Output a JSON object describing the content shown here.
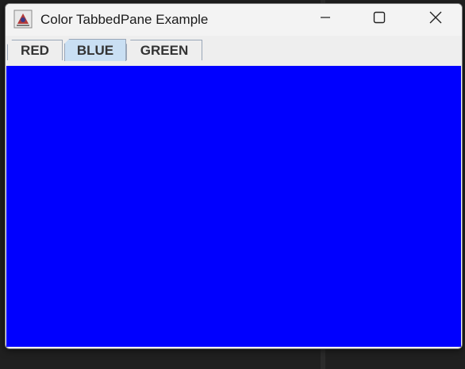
{
  "window": {
    "title": "Color TabbedPane Example"
  },
  "titlebar_buttons": {
    "minimize_icon": "minimize-icon",
    "maximize_icon": "maximize-icon",
    "close_icon": "close-icon"
  },
  "tabs": [
    {
      "label": "RED",
      "selected": false
    },
    {
      "label": "BLUE",
      "selected": true
    },
    {
      "label": "GREEN",
      "selected": false
    }
  ],
  "content": {
    "color": "#0000ff"
  },
  "colors": {
    "selected_tab_bg": "#c9dff3",
    "panel_blue": "#0000ff"
  }
}
